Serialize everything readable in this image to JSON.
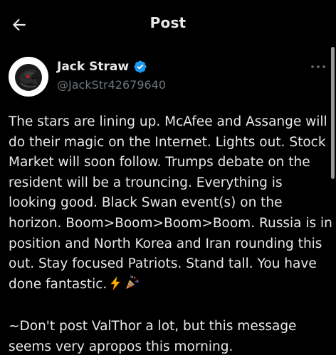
{
  "header": {
    "title": "Post",
    "back_icon": "back-arrow-icon"
  },
  "author": {
    "display_name": "Jack Straw",
    "handle": "@JackStr42679640",
    "verified_color": "#1d9bf0",
    "avatar_icon": "raven-avatar"
  },
  "more_icon": "more-dots-icon",
  "tweet": {
    "paragraph1": "The stars are lining up. McAfee and Assange will do their magic on the Internet. Lights out. Stock Market will soon follow. Trumps debate on the resident will be a trouncing. Everything is looking good. Black Swan event(s) on the horizon. Boom>Boom>Boom>Boom. Russia is in position and North Korea and Iran rounding this out. Stay focused Patriots. Stand tall. You have done fantastic.",
    "emojis": [
      "lightning-emoji",
      "party-popper-emoji"
    ],
    "paragraph2": "~Don't post ValThor a lot, but this message seems very apropos this morning."
  },
  "colors": {
    "background": "#000000",
    "text": "#e7e9ea",
    "secondary": "#71767b",
    "accent": "#1d9bf0"
  }
}
